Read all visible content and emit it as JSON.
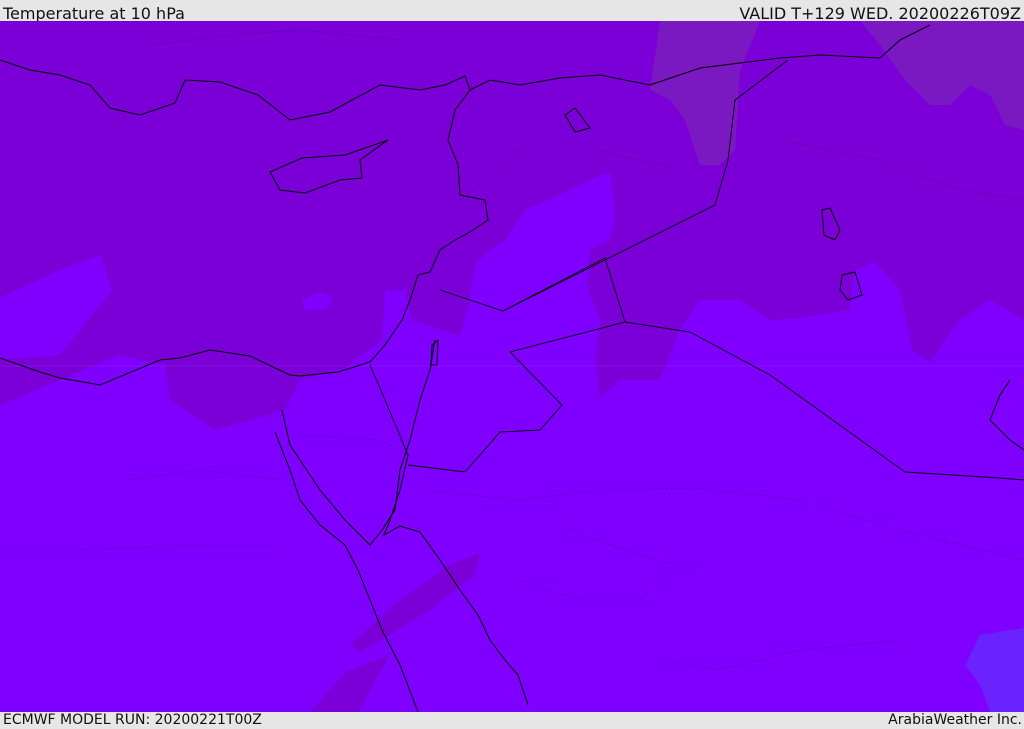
{
  "header": {
    "title": "Temperature at 10 hPa",
    "valid_time": "VALID T+129 WED. 20200226T09Z"
  },
  "footer": {
    "model_run": "ECMWF MODEL RUN: 20200221T00Z",
    "credit": "ArabiaWeather Inc."
  },
  "colors": {
    "field_warm": "#7f00ff",
    "field_cool": "#7b00d8",
    "field_coolest": "#7a18c2",
    "field_southeast": "#6a22ff",
    "header_bg": "#e6e6e6"
  }
}
